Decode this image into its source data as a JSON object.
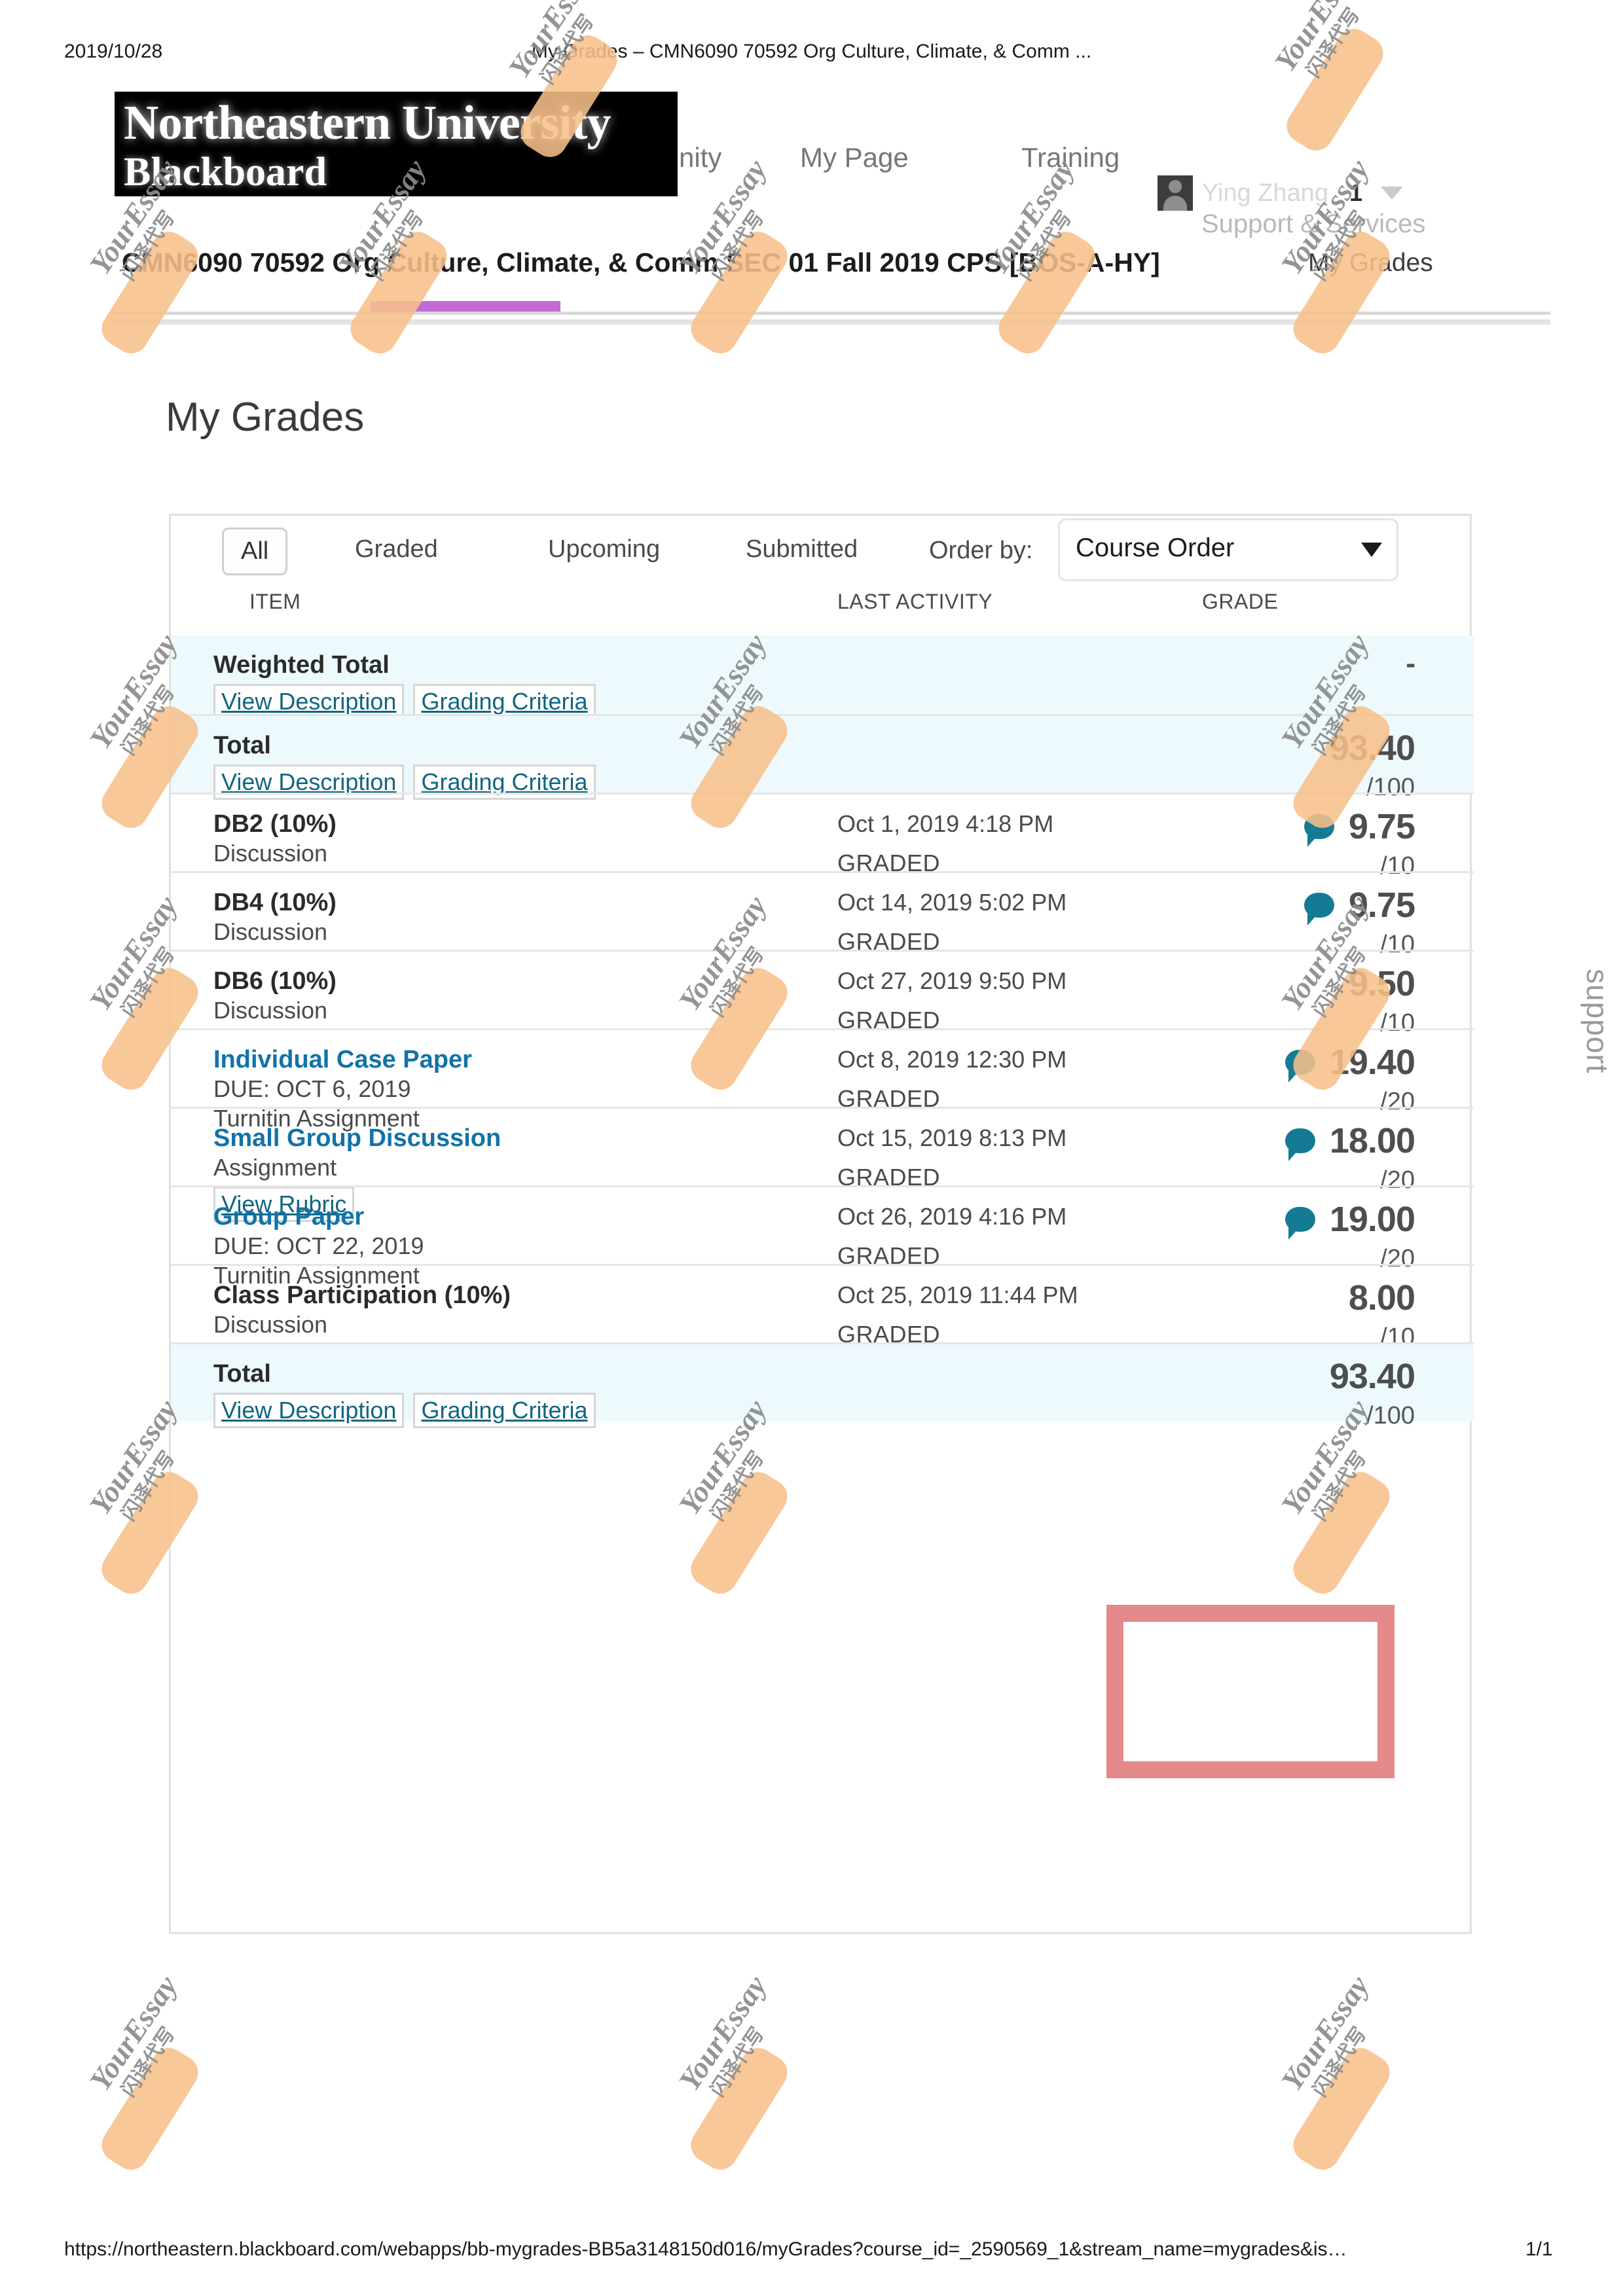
{
  "print": {
    "date": "2019/10/28",
    "title": "My Grades – CMN6090 70592 Org Culture, Climate, & Comm ...",
    "url": "https://northeastern.blackboard.com/webapps/bb-mygrades-BB5a3148150d016/myGrades?course_id=_2590569_1&stream_name=mygrades&is…",
    "page": "1/1"
  },
  "header": {
    "logo_line1": "Northeastern University",
    "logo_line2": "Blackboard",
    "nav": [
      {
        "label": "Community",
        "name": "nav-community"
      },
      {
        "label": "My Page",
        "name": "nav-my-page"
      },
      {
        "label": "Training",
        "name": "nav-training"
      }
    ],
    "user_name": "Ying Zhang",
    "user_count": "1",
    "support_services": "Support & Services",
    "accent_color": "#c36ad4"
  },
  "breadcrumb": {
    "course": "CMN6090 70592 Org Culture, Climate, & Comm SEC 01 Fall 2019 CPS [BOS-A-HY]",
    "current": "My Grades"
  },
  "page": {
    "title": "My Grades",
    "support_tab": "support"
  },
  "filters": {
    "tabs": [
      {
        "label": "All",
        "active": true
      },
      {
        "label": "Graded",
        "active": false
      },
      {
        "label": "Upcoming",
        "active": false
      },
      {
        "label": "Submitted",
        "active": false
      }
    ],
    "order_by_label": "Order by:",
    "order_by_value": "Course Order"
  },
  "table": {
    "columns": [
      "ITEM",
      "LAST ACTIVITY",
      "GRADE"
    ],
    "rows": [
      {
        "name": "Weighted Total",
        "is_link": false,
        "sub": [],
        "buttons": [
          "View Description",
          "Grading Criteria"
        ],
        "last_activity": "",
        "status": "",
        "grade": "-",
        "out_of": "",
        "has_comment": false,
        "total": true
      },
      {
        "name": "Total",
        "is_link": false,
        "sub": [],
        "buttons": [
          "View Description",
          "Grading Criteria"
        ],
        "last_activity": "",
        "status": "",
        "grade": "93.40",
        "out_of": "/100",
        "has_comment": false,
        "total": true
      },
      {
        "name": "DB2 (10%)",
        "is_link": false,
        "sub": [
          "Discussion"
        ],
        "buttons": [],
        "last_activity": "Oct 1, 2019 4:18 PM",
        "status": "GRADED",
        "grade": "9.75",
        "out_of": "/10",
        "has_comment": true,
        "total": false
      },
      {
        "name": "DB4 (10%)",
        "is_link": false,
        "sub": [
          "Discussion"
        ],
        "buttons": [],
        "last_activity": "Oct 14, 2019 5:02 PM",
        "status": "GRADED",
        "grade": "9.75",
        "out_of": "/10",
        "has_comment": true,
        "total": false
      },
      {
        "name": "DB6 (10%)",
        "is_link": false,
        "sub": [
          "Discussion"
        ],
        "buttons": [],
        "last_activity": "Oct 27, 2019 9:50 PM",
        "status": "GRADED",
        "grade": "9.50",
        "out_of": "/10",
        "has_comment": false,
        "total": false
      },
      {
        "name": "Individual Case Paper",
        "is_link": true,
        "sub": [
          "DUE: OCT 6, 2019",
          "Turnitin Assignment"
        ],
        "buttons": [],
        "last_activity": "Oct 8, 2019 12:30 PM",
        "status": "GRADED",
        "grade": "19.40",
        "out_of": "/20",
        "has_comment": true,
        "total": false
      },
      {
        "name": "Small Group Discussion",
        "is_link": true,
        "sub": [
          "Assignment"
        ],
        "buttons": [
          "View Rubric"
        ],
        "last_activity": "Oct 15, 2019 8:13 PM",
        "status": "GRADED",
        "grade": "18.00",
        "out_of": "/20",
        "has_comment": true,
        "total": false
      },
      {
        "name": "Group Paper",
        "is_link": true,
        "sub": [
          "DUE: OCT 22, 2019",
          "Turnitin Assignment"
        ],
        "buttons": [],
        "last_activity": "Oct 26, 2019 4:16 PM",
        "status": "GRADED",
        "grade": "19.00",
        "out_of": "/20",
        "has_comment": true,
        "total": false
      },
      {
        "name": "Class Participation (10%)",
        "is_link": false,
        "sub": [
          "Discussion"
        ],
        "buttons": [],
        "last_activity": "Oct 25, 2019 11:44 PM",
        "status": "GRADED",
        "grade": "8.00",
        "out_of": "/10",
        "has_comment": false,
        "total": false
      },
      {
        "name": "Total",
        "is_link": false,
        "sub": [],
        "buttons": [
          "View Description",
          "Grading Criteria"
        ],
        "last_activity": "",
        "status": "",
        "grade": "93.40",
        "out_of": "/100",
        "has_comment": false,
        "total": true,
        "highlighted": true
      }
    ]
  },
  "watermark": {
    "brand": "YourEssay",
    "cn": "闪译代写",
    "color": "#f7c08a"
  }
}
